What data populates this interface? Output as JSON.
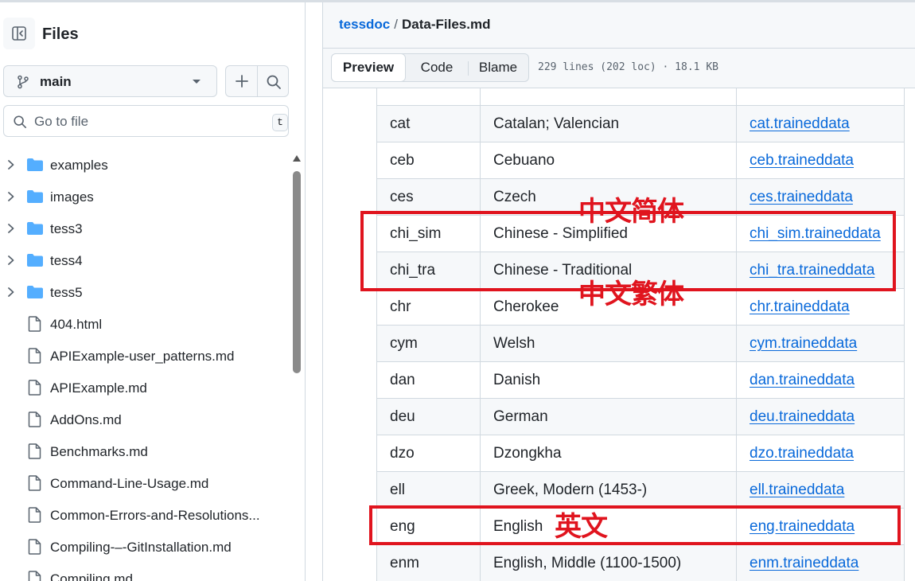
{
  "sidebar": {
    "title": "Files",
    "branch": "main",
    "search_placeholder": "Go to file",
    "search_shortcut": "t",
    "items": [
      {
        "label": "examples",
        "type": "folder"
      },
      {
        "label": "images",
        "type": "folder"
      },
      {
        "label": "tess3",
        "type": "folder"
      },
      {
        "label": "tess4",
        "type": "folder"
      },
      {
        "label": "tess5",
        "type": "folder"
      },
      {
        "label": "404.html",
        "type": "file"
      },
      {
        "label": "APIExample-user_patterns.md",
        "type": "file"
      },
      {
        "label": "APIExample.md",
        "type": "file"
      },
      {
        "label": "AddOns.md",
        "type": "file"
      },
      {
        "label": "Benchmarks.md",
        "type": "file"
      },
      {
        "label": "Command-Line-Usage.md",
        "type": "file"
      },
      {
        "label": "Common-Errors-and-Resolutions...",
        "type": "file"
      },
      {
        "label": "Compiling-–-GitInstallation.md",
        "type": "file"
      },
      {
        "label": "Compiling.md",
        "type": "file"
      }
    ]
  },
  "header": {
    "repo": "tessdoc",
    "separator": "/",
    "file": "Data-Files.md"
  },
  "toolbar": {
    "tabs": [
      {
        "label": "Preview",
        "active": true
      },
      {
        "label": "Code",
        "active": false
      },
      {
        "label": "Blame",
        "active": false
      }
    ],
    "file_info": "229 lines (202 loc) · 18.1 KB"
  },
  "table": {
    "rows": [
      {
        "code": "",
        "language": "",
        "file": ""
      },
      {
        "code": "cat",
        "language": "Catalan; Valencian",
        "file": "cat.traineddata"
      },
      {
        "code": "ceb",
        "language": "Cebuano",
        "file": "ceb.traineddata"
      },
      {
        "code": "ces",
        "language": "Czech",
        "file": "ces.traineddata"
      },
      {
        "code": "chi_sim",
        "language": "Chinese - Simplified",
        "file": "chi_sim.traineddata"
      },
      {
        "code": "chi_tra",
        "language": "Chinese - Traditional",
        "file": "chi_tra.traineddata"
      },
      {
        "code": "chr",
        "language": "Cherokee",
        "file": "chr.traineddata"
      },
      {
        "code": "cym",
        "language": "Welsh",
        "file": "cym.traineddata"
      },
      {
        "code": "dan",
        "language": "Danish",
        "file": "dan.traineddata"
      },
      {
        "code": "deu",
        "language": "German",
        "file": "deu.traineddata"
      },
      {
        "code": "dzo",
        "language": "Dzongkha",
        "file": "dzo.traineddata"
      },
      {
        "code": "ell",
        "language": "Greek, Modern (1453-)",
        "file": "ell.traineddata"
      },
      {
        "code": "eng",
        "language": "English",
        "file": "eng.traineddata"
      },
      {
        "code": "enm",
        "language": "English, Middle (1100-1500)",
        "file": "enm.traineddata"
      }
    ]
  },
  "annotations": {
    "simplified": "中文简体",
    "traditional": "中文繁体",
    "english": "英文",
    "color": "#e0141e"
  },
  "colors": {
    "link": "#0969da",
    "border": "#d1d9e0",
    "folder": "#54aeff"
  }
}
